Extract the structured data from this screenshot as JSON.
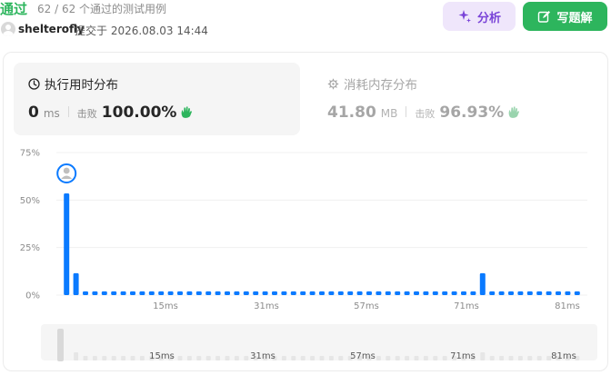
{
  "header": {
    "status": "通过",
    "cases": "62 / 62 个通过的测试用例",
    "username": "shelterofly",
    "submitted": "提交于 2026.08.03 14:44"
  },
  "buttons": {
    "analyze": "分析",
    "solution": "写题解"
  },
  "runtime": {
    "title": "执行用时分布",
    "value": "0",
    "unit": "ms",
    "beat_label": "击败",
    "beat": "100.00%"
  },
  "memory": {
    "title": "消耗内存分布",
    "value": "41.80",
    "unit": "MB",
    "beat_label": "击败",
    "beat": "96.93%"
  },
  "colors": {
    "accent_green": "#2db55d",
    "bar_blue": "#0a7aff",
    "analyze_purple": "#7a44d8"
  },
  "chart_data": {
    "type": "bar",
    "ylim": [
      0,
      75
    ],
    "yticks": [
      "75%",
      "50%",
      "25%",
      "0%"
    ],
    "xtick_labels": [
      "15ms",
      "31ms",
      "57ms",
      "71ms",
      "81ms"
    ],
    "values": [
      53.5,
      11.5,
      2,
      2,
      2,
      2,
      2,
      2,
      2,
      2,
      2,
      2,
      2,
      2,
      2,
      2,
      2,
      2,
      2,
      2,
      2,
      2,
      2,
      2,
      2,
      2,
      2,
      2,
      2,
      2,
      2,
      2,
      2,
      2,
      2,
      2,
      2,
      2,
      2,
      2,
      2,
      2,
      2,
      2,
      11.5,
      2,
      2,
      2,
      2,
      2,
      2,
      2,
      2,
      2,
      2
    ],
    "highlight_index": 0,
    "grid": true,
    "minimap_labels": [
      "15ms",
      "31ms",
      "57ms",
      "71ms",
      "81ms"
    ]
  }
}
